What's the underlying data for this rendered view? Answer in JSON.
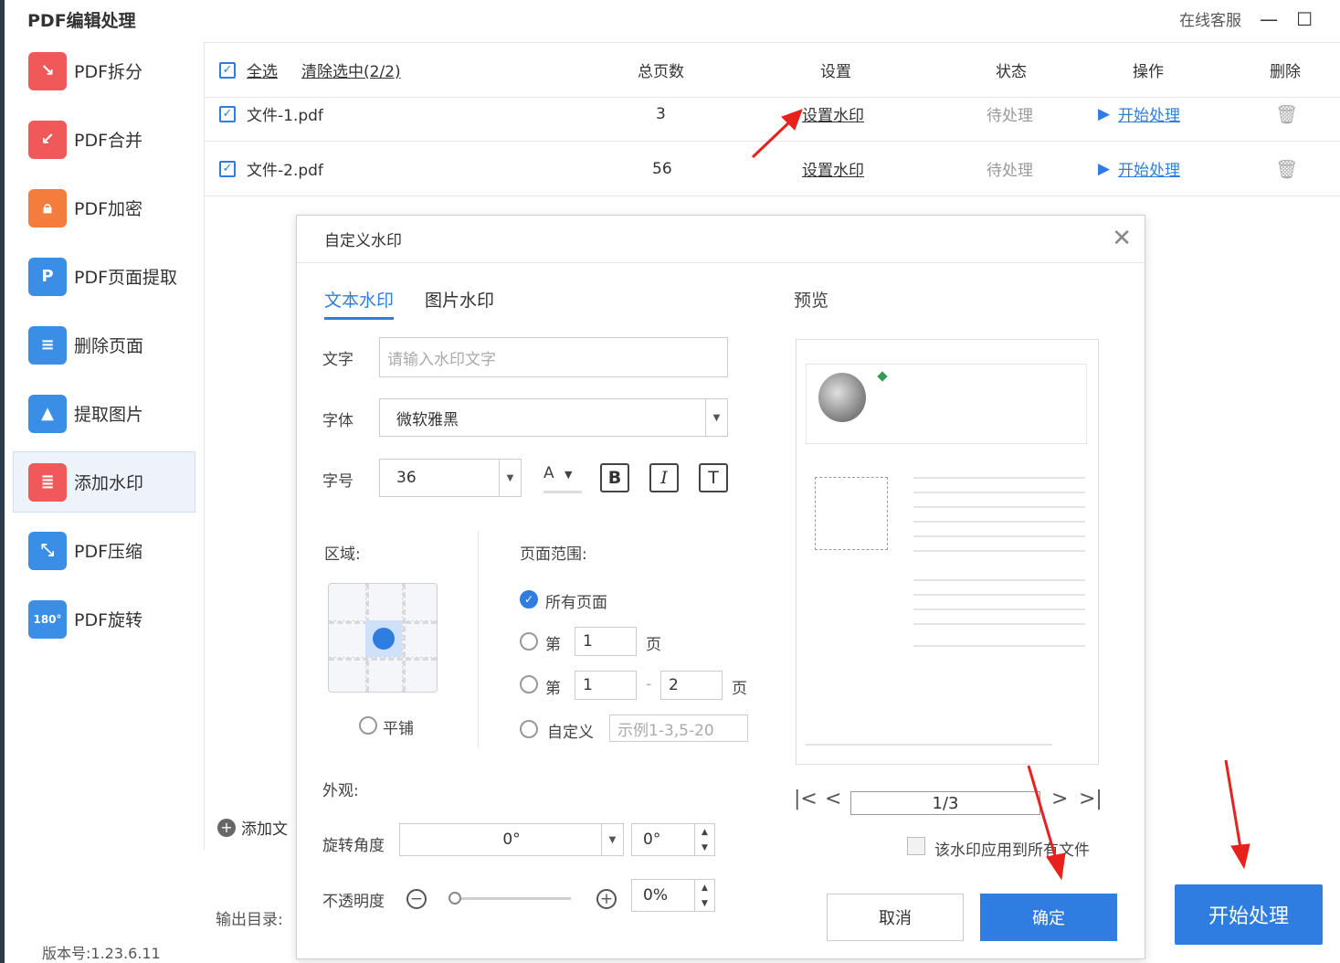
{
  "app": {
    "title": "PDF编辑处理",
    "support": "在线客服",
    "version": "版本号:1.23.6.11"
  },
  "sidebar": {
    "items": [
      {
        "label": "PDF拆分",
        "icon": "split-icon"
      },
      {
        "label": "PDF合并",
        "icon": "merge-icon"
      },
      {
        "label": "PDF加密",
        "icon": "lock-icon"
      },
      {
        "label": "PDF页面提取",
        "icon": "extract-page-icon"
      },
      {
        "label": "删除页面",
        "icon": "delete-page-icon"
      },
      {
        "label": "提取图片",
        "icon": "image-icon"
      },
      {
        "label": "添加水印",
        "icon": "watermark-icon"
      },
      {
        "label": "PDF压缩",
        "icon": "compress-icon"
      },
      {
        "label": "PDF旋转",
        "icon": "rotate-icon"
      }
    ],
    "active_index": 6
  },
  "table": {
    "select_all": "全选",
    "clear_selection": "清除选中(2/2)",
    "headers": {
      "pages": "总页数",
      "settings": "设置",
      "status": "状态",
      "action": "操作",
      "delete": "删除"
    },
    "rows": [
      {
        "name": "文件-1.pdf",
        "pages": "3",
        "setting": "设置水印",
        "status": "待处理",
        "action": "开始处理"
      },
      {
        "name": "文件-2.pdf",
        "pages": "56",
        "setting": "设置水印",
        "status": "待处理",
        "action": "开始处理"
      }
    ]
  },
  "footer": {
    "add_file": "添加文",
    "output_dir": "输出目录:",
    "start": "开始处理"
  },
  "dialog": {
    "title": "自定义水印",
    "tabs": [
      "文本水印",
      "图片水印"
    ],
    "active_tab": 0,
    "text_label": "文字",
    "text_placeholder": "请输入水印文字",
    "font_label": "字体",
    "font_value": "微软雅黑",
    "size_label": "字号",
    "size_value": "36",
    "color_glyph": "A",
    "bold": "B",
    "italic": "I",
    "text_style": "T",
    "area_label": "区域:",
    "tile_label": "平铺",
    "page_range_label": "页面范围:",
    "all_pages": "所有页面",
    "page_prefix": "第",
    "page_suffix": "页",
    "single_page_value": "1",
    "range_from": "1",
    "range_sep": "-",
    "range_to": "2",
    "custom_label": "自定义",
    "custom_placeholder": "示例1-3,5-20",
    "appearance_label": "外观:",
    "rotation_label": "旋转角度",
    "rotation_select": "0°",
    "rotation_value": "0°",
    "opacity_label": "不透明度",
    "opacity_minus": "−",
    "opacity_plus": "+",
    "opacity_value": "0%",
    "opacity_level": 0,
    "preview_label": "预览",
    "page_indicator": "1/3",
    "apply_all": "该水印应用到所有文件",
    "cancel": "取消",
    "confirm": "确定"
  },
  "colors": {
    "accent": "#2f7de1",
    "annotation_arrow": "#e8211c",
    "icon_red": "#f1585a",
    "icon_blue": "#3a8ee6"
  }
}
